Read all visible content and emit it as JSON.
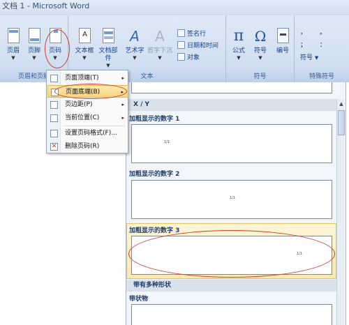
{
  "window": {
    "title": "文档 1 - Microsoft Word"
  },
  "ribbon": {
    "groups": {
      "header_footer": {
        "label": "页眉和页脚",
        "buttons": {
          "header": "页眉",
          "footer": "页脚",
          "page_number": "页码"
        }
      },
      "text": {
        "label": "文本",
        "buttons": {
          "textbox": "文本框",
          "quickparts": "文档部件",
          "wordart": "艺术字",
          "dropcap": "首字下沉",
          "signature": "签名行",
          "datetime": "日期和时间",
          "object": "对象"
        }
      },
      "symbols": {
        "label": "符号",
        "buttons": {
          "equation": "公式",
          "symbol": "符号",
          "number": "编号"
        }
      },
      "special": {
        "label": "特殊符号",
        "sym1": "，",
        "sym2": "。",
        "sym3": "；",
        "sym4": "：",
        "more": "符号"
      }
    },
    "arrow": "▼"
  },
  "menu": {
    "items": [
      {
        "label": "页面顶端(T)",
        "submenu": "▸"
      },
      {
        "label": "页面底端(B)",
        "submenu": "▸"
      },
      {
        "label": "页边距(P)",
        "submenu": "▸"
      },
      {
        "label": "当前位置(C)",
        "submenu": "▸"
      },
      {
        "label": "设置页码格式(F)..."
      },
      {
        "label": "删除页码(R)"
      }
    ]
  },
  "gallery": {
    "section_xy": "X / Y",
    "items": [
      {
        "title": "加粗显示的数字 1",
        "page_text": "1/1"
      },
      {
        "title": "加粗显示的数字 2",
        "page_text": "1/1"
      },
      {
        "title": "加粗显示的数字 3",
        "page_text": "1/1"
      }
    ],
    "section_shapes": "带有多种形状",
    "item_shape": "带状物"
  },
  "colors": {
    "highlight": "#f8d57e",
    "annotation": "#d03a2a",
    "ribbon_text": "#15428b"
  }
}
